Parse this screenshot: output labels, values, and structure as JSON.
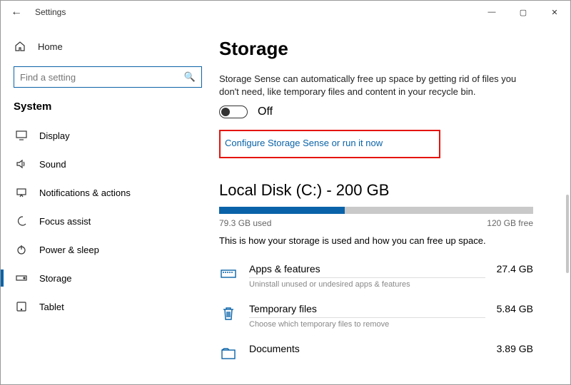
{
  "window": {
    "title": "Settings",
    "min": "—",
    "max": "▢",
    "close": "✕"
  },
  "sidebar": {
    "home": "Home",
    "search_placeholder": "Find a setting",
    "section": "System",
    "items": [
      {
        "label": "Display"
      },
      {
        "label": "Sound"
      },
      {
        "label": "Notifications & actions"
      },
      {
        "label": "Focus assist"
      },
      {
        "label": "Power & sleep"
      },
      {
        "label": "Storage",
        "selected": true
      },
      {
        "label": "Tablet"
      }
    ]
  },
  "main": {
    "title": "Storage",
    "sense_desc": "Storage Sense can automatically free up space by getting rid of files you don't need, like temporary files and content in your recycle bin.",
    "toggle_state": "Off",
    "configure_link": "Configure Storage Sense or run it now",
    "disk_heading": "Local Disk (C:) - 200 GB",
    "used_label": "79.3 GB used",
    "free_label": "120 GB free",
    "used_pct": 40,
    "how_used": "This is how your storage is used and how you can free up space.",
    "categories": [
      {
        "title": "Apps & features",
        "sub": "Uninstall unused or undesired apps & features",
        "size": "27.4 GB",
        "icon": "apps"
      },
      {
        "title": "Temporary files",
        "sub": "Choose which temporary files to remove",
        "size": "5.84 GB",
        "icon": "trash"
      },
      {
        "title": "Documents",
        "sub": "",
        "size": "3.89 GB",
        "icon": "doc"
      }
    ]
  }
}
